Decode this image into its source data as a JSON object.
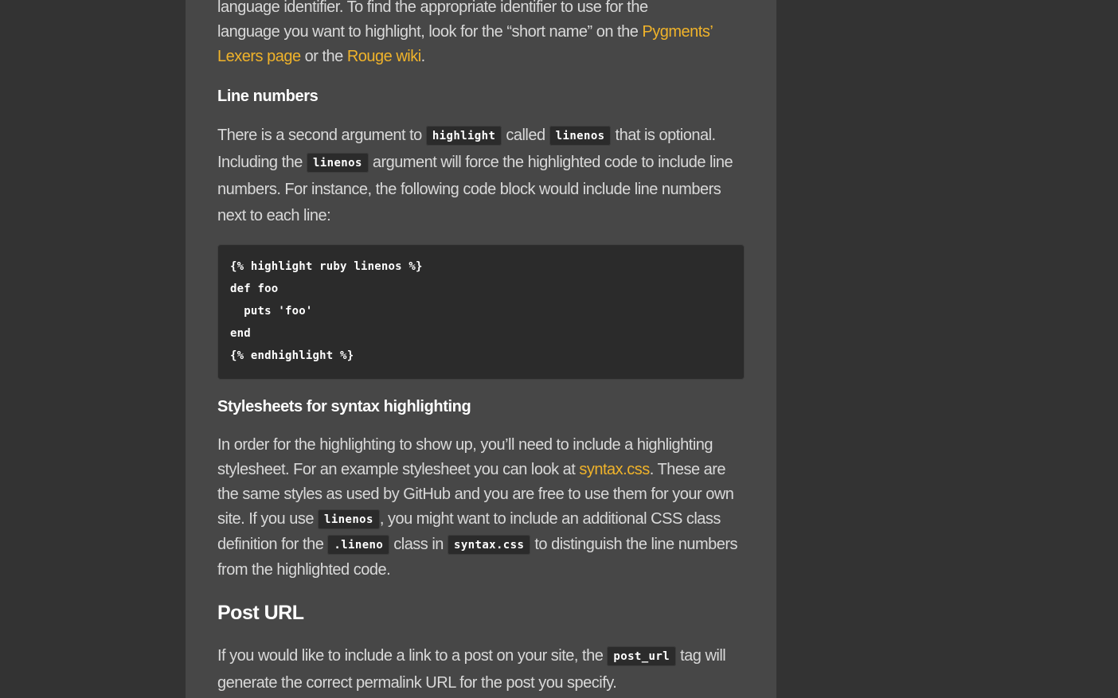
{
  "intro": {
    "line1": "language identifier. To find the appropriate identifier to use for the",
    "line2_prefix": "language you want to highlight, look for the “short name” on the ",
    "link_pygments": "Pygments’ Lexers page",
    "mid": " or the ",
    "link_rouge": "Rouge wiki",
    "end": "."
  },
  "line_numbers": {
    "heading": "Line numbers",
    "p1_a": "There is a second argument to ",
    "code_highlight": "highlight",
    "p1_b": " called ",
    "code_linenos": "linenos",
    "p1_c": " that is optional.",
    "p1_d": "Including the ",
    "p1_e": " argument will force the highlighted code to include line numbers. For instance, the following code block would include line numbers next to each line:",
    "code_block": [
      "{% highlight ruby linenos %}",
      "def foo",
      "  puts 'foo'",
      "end",
      "{% endhighlight %}"
    ]
  },
  "stylesheets": {
    "heading": "Stylesheets for syntax highlighting",
    "p_a": "In order for the highlighting to show up, you’ll need to include a highlighting stylesheet. For an example stylesheet you can look at ",
    "link_syntax": "syntax.css",
    "p_b": ". These are the same styles as used by GitHub and you are free to use them for your own site. If you use ",
    "code_linenos": "linenos",
    "p_c": ", you might want to include an additional CSS class definition for the ",
    "code_lineno": ".lineno",
    "p_d": " class in ",
    "code_syntax": "syntax.css",
    "p_e": " to distinguish the line numbers from the highlighted code."
  },
  "post_url": {
    "heading": "Post URL",
    "p_a": "If you would like to include a link to a post on your site, the ",
    "code_post_url": "post_url",
    "p_b": " tag will generate the correct permalink URL for the post you specify."
  }
}
